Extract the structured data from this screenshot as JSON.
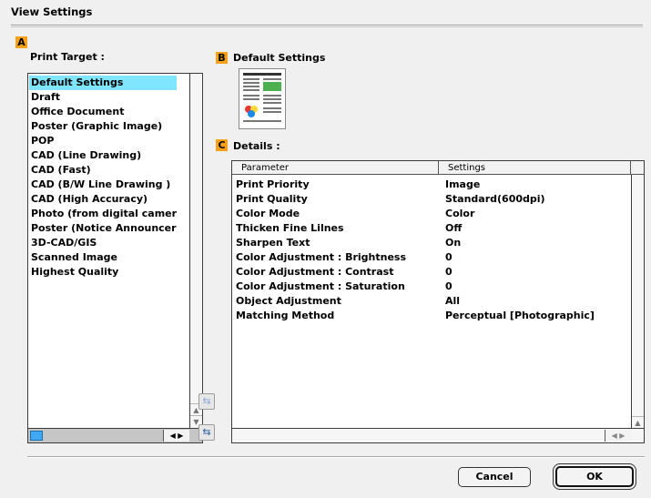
{
  "window": {
    "title": "View Settings"
  },
  "markers": {
    "a": "A",
    "b": "B",
    "c": "C"
  },
  "print_target": {
    "label": "Print Target :",
    "items": [
      "Default Settings",
      "Draft",
      "Office Document",
      "Poster (Graphic Image)",
      "POP",
      "CAD (Line Drawing)",
      "CAD (Fast)",
      "CAD (B/W Line Drawing )",
      "CAD (High Accuracy)",
      "Photo (from digital camer",
      "Poster (Notice Announcer",
      "3D-CAD/GIS",
      "Scanned Image",
      "Highest Quality"
    ],
    "selected_index": 0
  },
  "preview": {
    "label": "Default Settings"
  },
  "details": {
    "label": "Details :",
    "columns": [
      "Parameter",
      "Settings"
    ],
    "rows": [
      [
        "Print Priority",
        "Image"
      ],
      [
        "Print Quality",
        "Standard(600dpi)"
      ],
      [
        "Color Mode",
        "Color"
      ],
      [
        "Thicken Fine Lilnes",
        "Off"
      ],
      [
        "Sharpen Text",
        "On"
      ],
      [
        "Color Adjustment : Brightness",
        "0"
      ],
      [
        "Color Adjustment : Contrast",
        "0"
      ],
      [
        "Color Adjustment : Saturation",
        "0"
      ],
      [
        "Object Adjustment",
        "All"
      ],
      [
        "Matching Method",
        "Perceptual [Photographic]"
      ]
    ]
  },
  "buttons": {
    "cancel": "Cancel",
    "ok": "OK"
  },
  "colors": {
    "marker": "#f7a11b",
    "selection": "#80e6ff",
    "scroll_thumb": "#3fa9f5"
  }
}
